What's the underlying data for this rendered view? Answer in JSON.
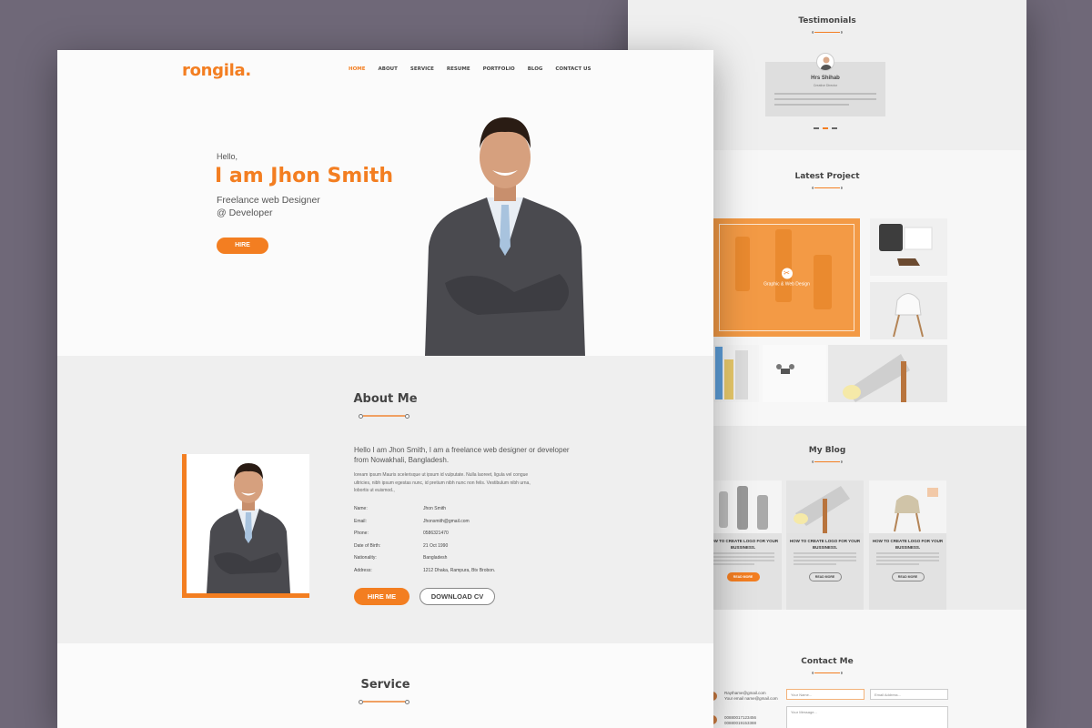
{
  "back": {
    "testimonials": {
      "title": "Testimonials",
      "name": "Hrs Shihab",
      "role": "Creative Director"
    },
    "latest_project": {
      "title": "Latest Project",
      "featured_caption": "Graphic & Web Design"
    },
    "blog": {
      "title": "My Blog",
      "posts": [
        {
          "title": "HOW TO CREATE LOGO FOR YOUR BUSSINESS.",
          "button": "READ MORE"
        },
        {
          "title": "HOW TO CREATE LOGO FOR YOUR BUSSINESS.",
          "button": "READ MORE"
        },
        {
          "title": "HOW TO CREATE LOGO FOR YOUR BUSSINESS.",
          "button": "READ MORE"
        }
      ]
    },
    "contact": {
      "title": "Contact Me",
      "email_lines": [
        "Raythame@gmail.com",
        "Your email name@gmail.com"
      ],
      "phone_lines": [
        "00880017123456",
        "00880019153388"
      ],
      "name_placeholder": "Your Name...",
      "email_placeholder": "Email Address...",
      "message_placeholder": "Your Message..."
    }
  },
  "front": {
    "logo": "rongila.",
    "nav": [
      "HOME",
      "ABOUT",
      "SERVICE",
      "RESUME",
      "PORTFOLIO",
      "BLOG",
      "CONTACT US"
    ],
    "hero": {
      "hello": "Hello,",
      "name": "I am Jhon Smith",
      "subtitle_line1": "Freelance web Designer",
      "subtitle_line2": "@ Developer",
      "button": "HIRE"
    },
    "about": {
      "title": "About Me",
      "lead": "Hello I am Jhon Smith, I am a freelance web designer or developer from Nowakhali, Bangladesh.",
      "body": "loream ipsum Mauris scelerisque ut ipsum id vulputate. Nulla laoreet, ligula vel congue ultricies, nibh ipsum egestas nunc, id pretium nibh nunc non felis. Vestibulum nibh urna, lobortis ut euismod.,",
      "details": [
        {
          "label": "Name:",
          "value": "Jhon Smith"
        },
        {
          "label": "Email:",
          "value": "Jhonsmith@gmail.com"
        },
        {
          "label": "Phone:",
          "value": "0586321470"
        },
        {
          "label": "Date of Birth:",
          "value": "21 Oct 1990"
        },
        {
          "label": "Nationality:",
          "value": "Bangladesh"
        },
        {
          "label": "Address:",
          "value": "1212 Dhaka, Rampura, Btv Brobon."
        }
      ],
      "hire_button": "HIRE ME",
      "cv_button": "DOWNLOAD CV"
    },
    "service": {
      "title": "Service"
    }
  },
  "colors": {
    "accent": "#f37e21",
    "backdrop": "#6f6878"
  }
}
